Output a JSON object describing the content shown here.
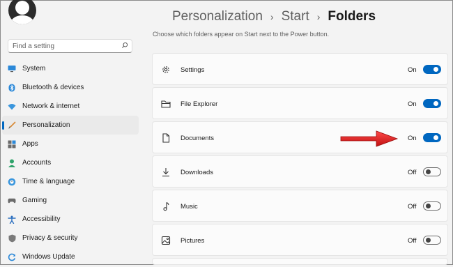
{
  "search": {
    "placeholder": "Find a setting"
  },
  "sidebar": {
    "items": [
      {
        "label": "System",
        "icon": "monitor-icon"
      },
      {
        "label": "Bluetooth & devices",
        "icon": "bluetooth-icon"
      },
      {
        "label": "Network & internet",
        "icon": "wifi-icon"
      },
      {
        "label": "Personalization",
        "icon": "brush-icon",
        "active": true
      },
      {
        "label": "Apps",
        "icon": "apps-icon"
      },
      {
        "label": "Accounts",
        "icon": "person-icon"
      },
      {
        "label": "Time & language",
        "icon": "globe-clock-icon"
      },
      {
        "label": "Gaming",
        "icon": "gamepad-icon"
      },
      {
        "label": "Accessibility",
        "icon": "accessibility-icon"
      },
      {
        "label": "Privacy & security",
        "icon": "shield-icon"
      },
      {
        "label": "Windows Update",
        "icon": "update-icon"
      }
    ]
  },
  "breadcrumb": {
    "part1": "Personalization",
    "part2": "Start",
    "current": "Folders",
    "separator": "›"
  },
  "description": "Choose which folders appear on Start next to the Power button.",
  "folders": [
    {
      "label": "Settings",
      "state": "On",
      "on": true,
      "icon": "gear-icon"
    },
    {
      "label": "File Explorer",
      "state": "On",
      "on": true,
      "icon": "folder-icon"
    },
    {
      "label": "Documents",
      "state": "On",
      "on": true,
      "icon": "document-icon"
    },
    {
      "label": "Downloads",
      "state": "Off",
      "on": false,
      "icon": "download-icon"
    },
    {
      "label": "Music",
      "state": "Off",
      "on": false,
      "icon": "music-note-icon"
    },
    {
      "label": "Pictures",
      "state": "Off",
      "on": false,
      "icon": "picture-icon"
    }
  ],
  "colors": {
    "accent": "#0067c0",
    "annotation_arrow": "#e01e1e"
  }
}
